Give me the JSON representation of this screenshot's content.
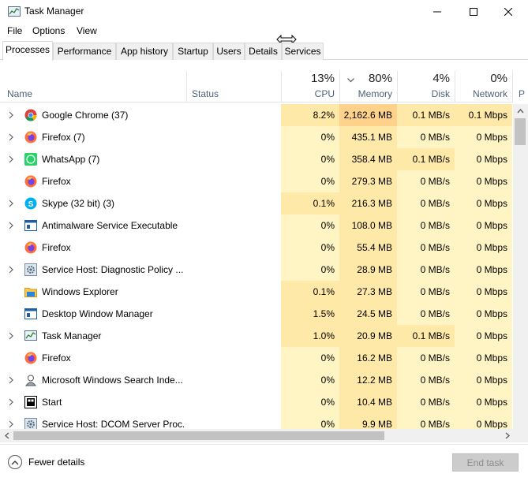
{
  "window": {
    "title": "Task Manager"
  },
  "menu": [
    "File",
    "Options",
    "View"
  ],
  "tabs": [
    "Processes",
    "Performance",
    "App history",
    "Startup",
    "Users",
    "Details",
    "Services"
  ],
  "columns": {
    "name": "Name",
    "status": "Status",
    "cpu": {
      "pct": "13%",
      "label": "CPU"
    },
    "memory": {
      "pct": "80%",
      "label": "Memory"
    },
    "disk": {
      "pct": "4%",
      "label": "Disk"
    },
    "network": {
      "pct": "0%",
      "label": "Network"
    },
    "power": "P"
  },
  "processes": [
    {
      "name": "Google Chrome (37)",
      "icon": "chrome-icon",
      "expand": true,
      "cpu": "8.2%",
      "memory": "2,162.6 MB",
      "disk": "0.1 MB/s",
      "network": "0.1 Mbps"
    },
    {
      "name": "Firefox (7)",
      "icon": "firefox-icon",
      "expand": true,
      "cpu": "0%",
      "memory": "435.1 MB",
      "disk": "0 MB/s",
      "network": "0 Mbps"
    },
    {
      "name": "WhatsApp (7)",
      "icon": "whatsapp-icon",
      "expand": true,
      "cpu": "0%",
      "memory": "358.4 MB",
      "disk": "0.1 MB/s",
      "network": "0 Mbps"
    },
    {
      "name": "Firefox",
      "icon": "firefox-icon",
      "expand": false,
      "cpu": "0%",
      "memory": "279.3 MB",
      "disk": "0 MB/s",
      "network": "0 Mbps"
    },
    {
      "name": "Skype (32 bit) (3)",
      "icon": "skype-icon",
      "expand": true,
      "cpu": "0.1%",
      "memory": "216.3 MB",
      "disk": "0 MB/s",
      "network": "0 Mbps"
    },
    {
      "name": "Antimalware Service Executable",
      "icon": "service-window-icon",
      "expand": true,
      "cpu": "0%",
      "memory": "108.0 MB",
      "disk": "0 MB/s",
      "network": "0 Mbps"
    },
    {
      "name": "Firefox",
      "icon": "firefox-icon",
      "expand": false,
      "cpu": "0%",
      "memory": "55.4 MB",
      "disk": "0 MB/s",
      "network": "0 Mbps"
    },
    {
      "name": "Service Host: Diagnostic Policy ...",
      "icon": "gear-icon",
      "expand": true,
      "cpu": "0%",
      "memory": "28.9 MB",
      "disk": "0 MB/s",
      "network": "0 Mbps"
    },
    {
      "name": "Windows Explorer",
      "icon": "folder-icon",
      "expand": false,
      "cpu": "0.1%",
      "memory": "27.3 MB",
      "disk": "0 MB/s",
      "network": "0 Mbps"
    },
    {
      "name": "Desktop Window Manager",
      "icon": "service-window-icon",
      "expand": false,
      "cpu": "1.5%",
      "memory": "24.5 MB",
      "disk": "0 MB/s",
      "network": "0 Mbps"
    },
    {
      "name": "Task Manager",
      "icon": "task-manager-icon",
      "expand": true,
      "cpu": "1.0%",
      "memory": "20.9 MB",
      "disk": "0.1 MB/s",
      "network": "0 Mbps"
    },
    {
      "name": "Firefox",
      "icon": "firefox-icon",
      "expand": false,
      "cpu": "0%",
      "memory": "16.2 MB",
      "disk": "0 MB/s",
      "network": "0 Mbps"
    },
    {
      "name": "Microsoft Windows Search Inde...",
      "icon": "search-indexer-icon",
      "expand": true,
      "cpu": "0%",
      "memory": "12.2 MB",
      "disk": "0 MB/s",
      "network": "0 Mbps"
    },
    {
      "name": "Start",
      "icon": "start-icon",
      "expand": true,
      "cpu": "0%",
      "memory": "10.4 MB",
      "disk": "0 MB/s",
      "network": "0 Mbps"
    },
    {
      "name": "Service Host: DCOM Server Proc...",
      "icon": "gear-icon",
      "expand": true,
      "cpu": "0%",
      "memory": "9.9 MB",
      "disk": "0 MB/s",
      "network": "0 Mbps"
    }
  ],
  "footer": {
    "fewer_details": "Fewer details",
    "end_task": "End task"
  },
  "colors": {
    "heat_light": "#fff4c4",
    "heat_mid": "#ffe9a8",
    "heat_hot": "#ffd28c",
    "header_text": "#4c607a",
    "accent": "#1e90ff"
  }
}
